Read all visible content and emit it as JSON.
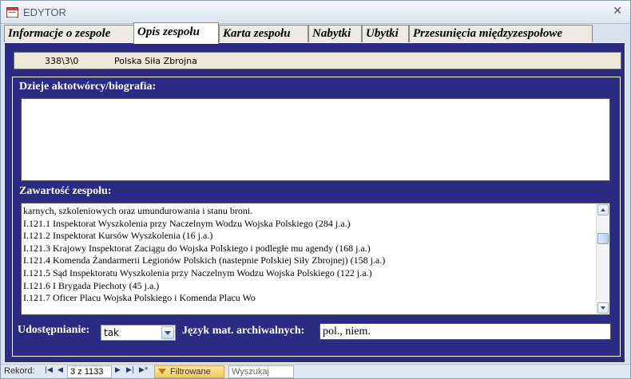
{
  "window": {
    "title": "EDYTOR",
    "close_label": "✕"
  },
  "tabs": [
    {
      "label": "Informacje o zespole",
      "active": false
    },
    {
      "label": "Opis zespołu",
      "active": true
    },
    {
      "label": "Karta zespołu",
      "active": false
    },
    {
      "label": "Nabytki",
      "active": false
    },
    {
      "label": "Ubytki",
      "active": false
    },
    {
      "label": "Przesunięcia międzyzespołowe",
      "active": false
    }
  ],
  "record_header": {
    "signature": "338\\3\\0",
    "name": "Polska Siła Zbrojna"
  },
  "form": {
    "bio_label": "Dzieje aktotwórcy/biografia:",
    "bio_value": "",
    "content_label": "Zawartość zespołu:",
    "content_lines": [
      "karnych, szkoleniowych oraz umundurowania i stanu broni.",
      "I.121.1 Inspektorat Wyszkolenia przy Naczelnym Wodzu Wojska Polskiego (284 j.a.)",
      "I.121.2 Inspektorat Kursów Wyszkolenia (16 j.a.)",
      "I.121.3 Krajowy Inspektorat Zaciągu do Wojska Polskiego i podległe mu agendy (168 j.a.)",
      "I.121.4 Komenda Żandarmerii Legionów Polskich (nastepnie Polskiej Siły Zbrojnej) (158 j.a.)",
      "I.121.5 Sąd Inspektoratu Wyszkolenia przy Naczelnym Wodzu Wojska Polskiego (122 j.a.)",
      "I.121.6 I Brygada Piechoty (45 j.a.)",
      "I.121.7 Oficer Placu Wojska Polskiego i Komenda Placu Wo"
    ],
    "access_label": "Udostępnianie:",
    "access_value": "tak",
    "language_label": "Język mat. archiwalnych:",
    "language_value": "pol., niem."
  },
  "statusbar": {
    "record_label": "Rekord:",
    "record_position": "3 z 1133",
    "filter_label": "Filtrowane",
    "search_placeholder": "Wyszukaj"
  }
}
